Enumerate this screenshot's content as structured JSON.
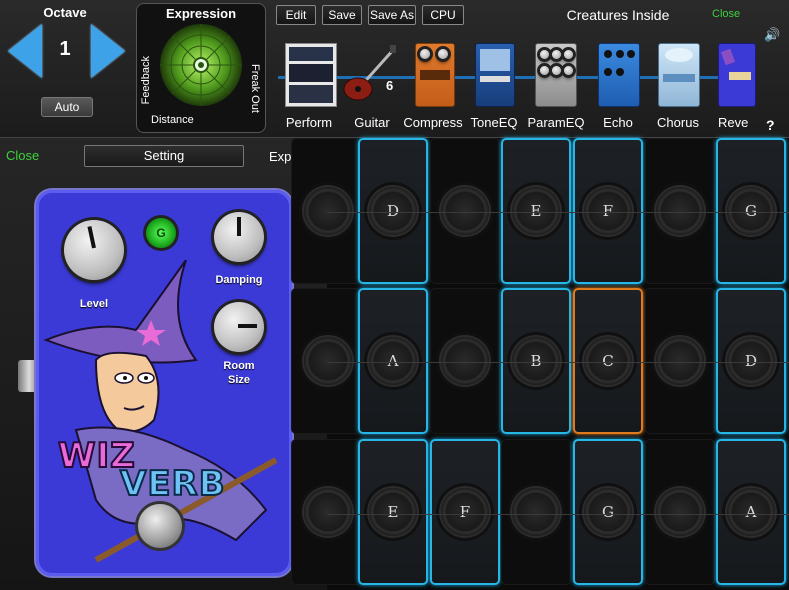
{
  "octave": {
    "label": "Octave",
    "value": "1",
    "auto_label": "Auto"
  },
  "expression": {
    "title": "Expression",
    "left_label": "Feedback",
    "right_label": "Freak Out",
    "bottom_label": "Distance"
  },
  "toolbar": {
    "edit": "Edit",
    "save": "Save",
    "save_as": "Save As",
    "cpu": "CPU"
  },
  "header": {
    "title": "Creatures Inside",
    "close": "Close",
    "help": "?"
  },
  "chain": [
    {
      "label": "Perform"
    },
    {
      "label": "Guitar",
      "badge": "6"
    },
    {
      "label": "Compress"
    },
    {
      "label": "ToneEQ"
    },
    {
      "label": "ParamEQ"
    },
    {
      "label": "Echo"
    },
    {
      "label": "Chorus"
    },
    {
      "label": "Reve"
    }
  ],
  "panel": {
    "close": "Close",
    "setting": "Setting",
    "expert": "Expert >"
  },
  "pedal": {
    "knobs": {
      "level": "Level",
      "damping": "Damping",
      "room_size_1": "Room",
      "room_size_2": "Size"
    },
    "logo_line1": "WIZ",
    "logo_line2": "VERB",
    "led": "G"
  },
  "grid": {
    "rows": [
      [
        "",
        "D",
        "",
        "E",
        "F",
        "",
        "G"
      ],
      [
        "",
        "A",
        "",
        "B",
        "C",
        "",
        "D"
      ],
      [
        "",
        "E",
        "F",
        "",
        "G",
        "",
        "A"
      ]
    ]
  },
  "colors": {
    "pad_active": "#27b6e6",
    "pad_selected": "#e07a1f",
    "arrow": "#3ea2e8",
    "close_green": "#3cd23c"
  }
}
